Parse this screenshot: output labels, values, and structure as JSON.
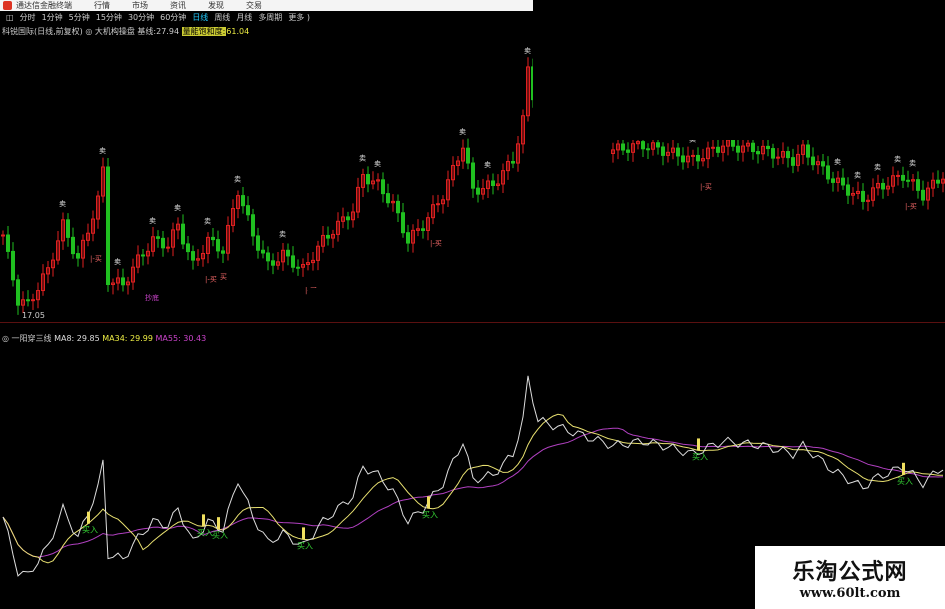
{
  "titlebar": {
    "app": "通达信金融终端",
    "menus": [
      "行情",
      "市场",
      "资讯",
      "发现",
      "交易"
    ]
  },
  "periods": [
    "分时",
    "1分钟",
    "5分钟",
    "15分钟",
    "30分钟",
    "60分钟",
    "日线",
    "周线",
    "月线",
    "多周期",
    "更多 )"
  ],
  "active_period": "日线",
  "info": {
    "stock": "科锐国际(日线,前复权)",
    "indicator": "大机构操盘",
    "base_label": "基线:",
    "base_value": "27.94",
    "sat_label": "量能饱和度:",
    "sat_value": "61.04"
  },
  "main": {
    "low_label": "17.05",
    "buy_label": "买",
    "sell_label": "卖",
    "bottom_label": "抄底"
  },
  "indicator": {
    "name": "一阳穿三线",
    "ma8": "MA8: 29.85",
    "ma34": "MA34: 29.99",
    "ma55": "MA55: 30.43",
    "buy_label": "买入"
  },
  "watermark": {
    "title": "乐淘公式网",
    "url": "www.60lt.com"
  },
  "colors": {
    "up": "#e02020",
    "down": "#20c020",
    "ma8": "#dddddd",
    "ma34": "#e8e070",
    "ma55": "#b040c0"
  },
  "chart_data": {
    "type": "candlestick",
    "price_anchors": [
      [
        0,
        25.4
      ],
      [
        3,
        18.1
      ],
      [
        5,
        17.6
      ],
      [
        9,
        21.5
      ],
      [
        12,
        26.5
      ],
      [
        15,
        22.6
      ],
      [
        19,
        29.3
      ],
      [
        20,
        32.7
      ],
      [
        21,
        20.4
      ],
      [
        24,
        19.8
      ],
      [
        27,
        22.6
      ],
      [
        30,
        24.8
      ],
      [
        33,
        24.3
      ],
      [
        35,
        26.5
      ],
      [
        38,
        22.0
      ],
      [
        41,
        24.8
      ],
      [
        44,
        23.7
      ],
      [
        47,
        30.4
      ],
      [
        50,
        25.4
      ],
      [
        53,
        22.0
      ],
      [
        56,
        23.2
      ],
      [
        60,
        21.5
      ],
      [
        64,
        24.8
      ],
      [
        70,
        28.2
      ],
      [
        72,
        32.1
      ],
      [
        75,
        31.0
      ],
      [
        78,
        28.8
      ],
      [
        81,
        24.8
      ],
      [
        84,
        26.5
      ],
      [
        88,
        29.9
      ],
      [
        92,
        35.5
      ],
      [
        94,
        30.4
      ],
      [
        98,
        31.0
      ],
      [
        102,
        33.8
      ],
      [
        104,
        38.3
      ],
      [
        105,
        43.9
      ],
      [
        107,
        38.3
      ],
      [
        122,
        34.9
      ],
      [
        128,
        35.5
      ],
      [
        132,
        34.9
      ],
      [
        138,
        33.8
      ],
      [
        144,
        35.5
      ],
      [
        152,
        34.9
      ],
      [
        158,
        33.8
      ],
      [
        160,
        34.9
      ],
      [
        166,
        31.6
      ],
      [
        172,
        29.3
      ],
      [
        174,
        30.4
      ],
      [
        180,
        32.1
      ],
      [
        184,
        29.9
      ],
      [
        188,
        32.1
      ]
    ],
    "gap_bars": [
      108,
      121
    ],
    "buy_signal_bars": [
      17,
      40,
      43,
      60,
      85,
      139,
      180
    ]
  }
}
